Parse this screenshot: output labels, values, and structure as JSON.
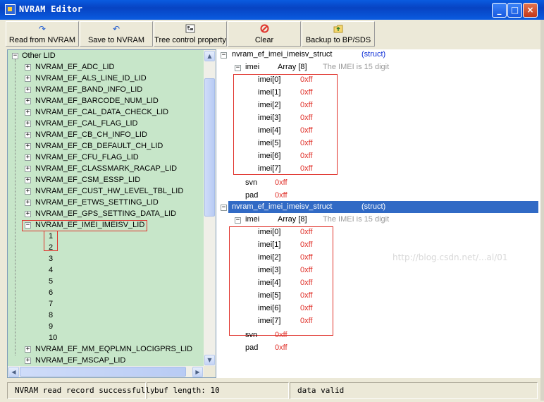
{
  "window": {
    "title": "NVRAM Editor",
    "minimize": "_",
    "maximize": "□",
    "close": "×"
  },
  "toolbar": {
    "read": {
      "label": "Read from NVRAM",
      "icon": "read-arrow-icon"
    },
    "save": {
      "label": "Save to NVRAM",
      "icon": "save-arrow-icon"
    },
    "tree": {
      "label": "Tree control property",
      "icon": "tree-property-icon"
    },
    "clear": {
      "label": "Clear",
      "icon": "clear-icon"
    },
    "backup": {
      "label": "Backup to BP/SDS",
      "icon": "backup-icon"
    }
  },
  "left_tree": {
    "root": "Other LID",
    "items": [
      "NVRAM_EF_ADC_LID",
      "NVRAM_EF_ALS_LINE_ID_LID",
      "NVRAM_EF_BAND_INFO_LID",
      "NVRAM_EF_BARCODE_NUM_LID",
      "NVRAM_EF_CAL_DATA_CHECK_LID",
      "NVRAM_EF_CAL_FLAG_LID",
      "NVRAM_EF_CB_CH_INFO_LID",
      "NVRAM_EF_CB_DEFAULT_CH_LID",
      "NVRAM_EF_CFU_FLAG_LID",
      "NVRAM_EF_CLASSMARK_RACAP_LID",
      "NVRAM_EF_CSM_ESSP_LID",
      "NVRAM_EF_CUST_HW_LEVEL_TBL_LID",
      "NVRAM_EF_ETWS_SETTING_LID",
      "NVRAM_EF_GPS_SETTING_DATA_LID",
      "NVRAM_EF_IMEI_IMEISV_LID"
    ],
    "records": [
      "1",
      "2",
      "3",
      "4",
      "5",
      "6",
      "7",
      "8",
      "9",
      "10"
    ],
    "after": [
      "NVRAM_EF_MM_EQPLMN_LOCIGPRS_LID",
      "NVRAM_EF_MSCAP_LID"
    ]
  },
  "right_tree": {
    "blocks": [
      {
        "struct_name": "nvram_ef_imei_imeisv_struct",
        "struct_type": "(struct)",
        "field": "imei",
        "field_type": "Array [8]",
        "comment": "The IMEI is 15 digit",
        "elements": [
          {
            "name": "imei[0]",
            "value": "0xff"
          },
          {
            "name": "imei[1]",
            "value": "0xff"
          },
          {
            "name": "imei[2]",
            "value": "0xff"
          },
          {
            "name": "imei[3]",
            "value": "0xff"
          },
          {
            "name": "imei[4]",
            "value": "0xff"
          },
          {
            "name": "imei[5]",
            "value": "0xff"
          },
          {
            "name": "imei[6]",
            "value": "0xff"
          },
          {
            "name": "imei[7]",
            "value": "0xff"
          }
        ],
        "svn": {
          "name": "svn",
          "value": "0xff"
        },
        "pad": {
          "name": "pad",
          "value": "0xff"
        }
      },
      {
        "struct_name": "nvram_ef_imei_imeisv_struct",
        "struct_type": "(struct)",
        "field": "imei",
        "field_type": "Array [8]",
        "comment": "The IMEI is 15 digit",
        "elements": [
          {
            "name": "imei[0]",
            "value": "0xff"
          },
          {
            "name": "imei[1]",
            "value": "0xff"
          },
          {
            "name": "imei[2]",
            "value": "0xff"
          },
          {
            "name": "imei[3]",
            "value": "0xff"
          },
          {
            "name": "imei[4]",
            "value": "0xff"
          },
          {
            "name": "imei[5]",
            "value": "0xff"
          },
          {
            "name": "imei[6]",
            "value": "0xff"
          },
          {
            "name": "imei[7]",
            "value": "0xff"
          }
        ],
        "svn": {
          "name": "svn",
          "value": "0xff"
        },
        "pad": {
          "name": "pad",
          "value": "0xff"
        }
      }
    ]
  },
  "watermark": "http://blog.csdn.net/...al/01",
  "status": {
    "message": "NVRAM read record successfully",
    "buf_length": "buf length: 10",
    "valid": "data valid"
  },
  "colors": {
    "title_bar": "#0a5be0",
    "tree_bg": "#c7e6c9",
    "selection": "#316ac5",
    "highlight_border": "#e0312a",
    "value_red": "#e0312a",
    "struct_blue": "#0a2bd6"
  }
}
